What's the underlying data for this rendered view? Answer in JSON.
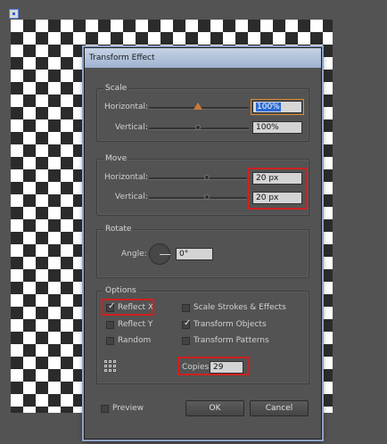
{
  "dialog": {
    "title": "Transform Effect"
  },
  "scale": {
    "legend": "Scale",
    "horizontal_label": "Horizontal:",
    "horizontal_value": "100%",
    "vertical_label": "Vertical:",
    "vertical_value": "100%"
  },
  "move": {
    "legend": "Move",
    "horizontal_label": "Horizontal:",
    "horizontal_value": "20 px",
    "vertical_label": "Vertical:",
    "vertical_value": "20 px"
  },
  "rotate": {
    "legend": "Rotate",
    "angle_label": "Angle:",
    "angle_value": "0°"
  },
  "options": {
    "legend": "Options",
    "reflect_x": "Reflect X",
    "reflect_y": "Reflect Y",
    "random": "Random",
    "scale_strokes": "Scale Strokes & Effects",
    "transform_objects": "Transform Objects",
    "transform_patterns": "Transform Patterns",
    "copies_label": "Copies",
    "copies_value": "29"
  },
  "footer": {
    "preview": "Preview",
    "ok": "OK",
    "cancel": "Cancel"
  },
  "colors": {
    "highlight_box": "#d02020",
    "selection": "#2b6ad3",
    "active_thumb": "#c97a39"
  }
}
